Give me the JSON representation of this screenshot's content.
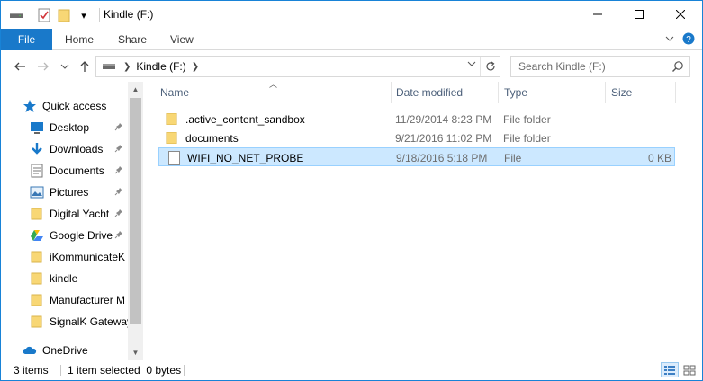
{
  "window": {
    "title": "Kindle (F:)",
    "qat_dropdown": "▾"
  },
  "ribbon": {
    "tabs": [
      {
        "label": "File"
      },
      {
        "label": "Home"
      },
      {
        "label": "Share"
      },
      {
        "label": "View"
      }
    ]
  },
  "address": {
    "location": "Kindle (F:)",
    "search_placeholder": "Search Kindle (F:)"
  },
  "sidebar": {
    "quick_access": "Quick access",
    "items": [
      {
        "label": "Desktop",
        "icon": "desktop-icon",
        "pinned": true
      },
      {
        "label": "Downloads",
        "icon": "downloads-icon",
        "pinned": true
      },
      {
        "label": "Documents",
        "icon": "documents-icon",
        "pinned": true
      },
      {
        "label": "Pictures",
        "icon": "pictures-icon",
        "pinned": true
      },
      {
        "label": "Digital Yacht",
        "icon": "folder-icon",
        "pinned": true
      },
      {
        "label": "Google Drive",
        "icon": "google-drive-icon",
        "pinned": true
      },
      {
        "label": "iKommunicateK",
        "icon": "folder-icon",
        "pinned": false
      },
      {
        "label": "kindle",
        "icon": "folder-icon",
        "pinned": false
      },
      {
        "label": "Manufacturer M",
        "icon": "folder-icon",
        "pinned": false
      },
      {
        "label": "SignalK Gateway",
        "icon": "folder-icon",
        "pinned": false
      }
    ],
    "onedrive": "OneDrive"
  },
  "columns": {
    "name": "Name",
    "date": "Date modified",
    "type": "Type",
    "size": "Size"
  },
  "files": [
    {
      "name": ".active_content_sandbox",
      "date": "11/29/2014 8:23 PM",
      "type": "File folder",
      "size": "",
      "kind": "folder"
    },
    {
      "name": "documents",
      "date": "9/21/2016 11:02 PM",
      "type": "File folder",
      "size": "",
      "kind": "folder"
    },
    {
      "name": "WIFI_NO_NET_PROBE",
      "date": "9/18/2016 5:18 PM",
      "type": "File",
      "size": "0 KB",
      "kind": "file",
      "selected": true
    }
  ],
  "status": {
    "item_count": "3 items",
    "selection": "1 item selected  0 bytes"
  },
  "colors": {
    "accent": "#1979ca",
    "selection_bg": "#cce8ff",
    "selection_border": "#99d1ff",
    "folder": "#f8d775"
  }
}
